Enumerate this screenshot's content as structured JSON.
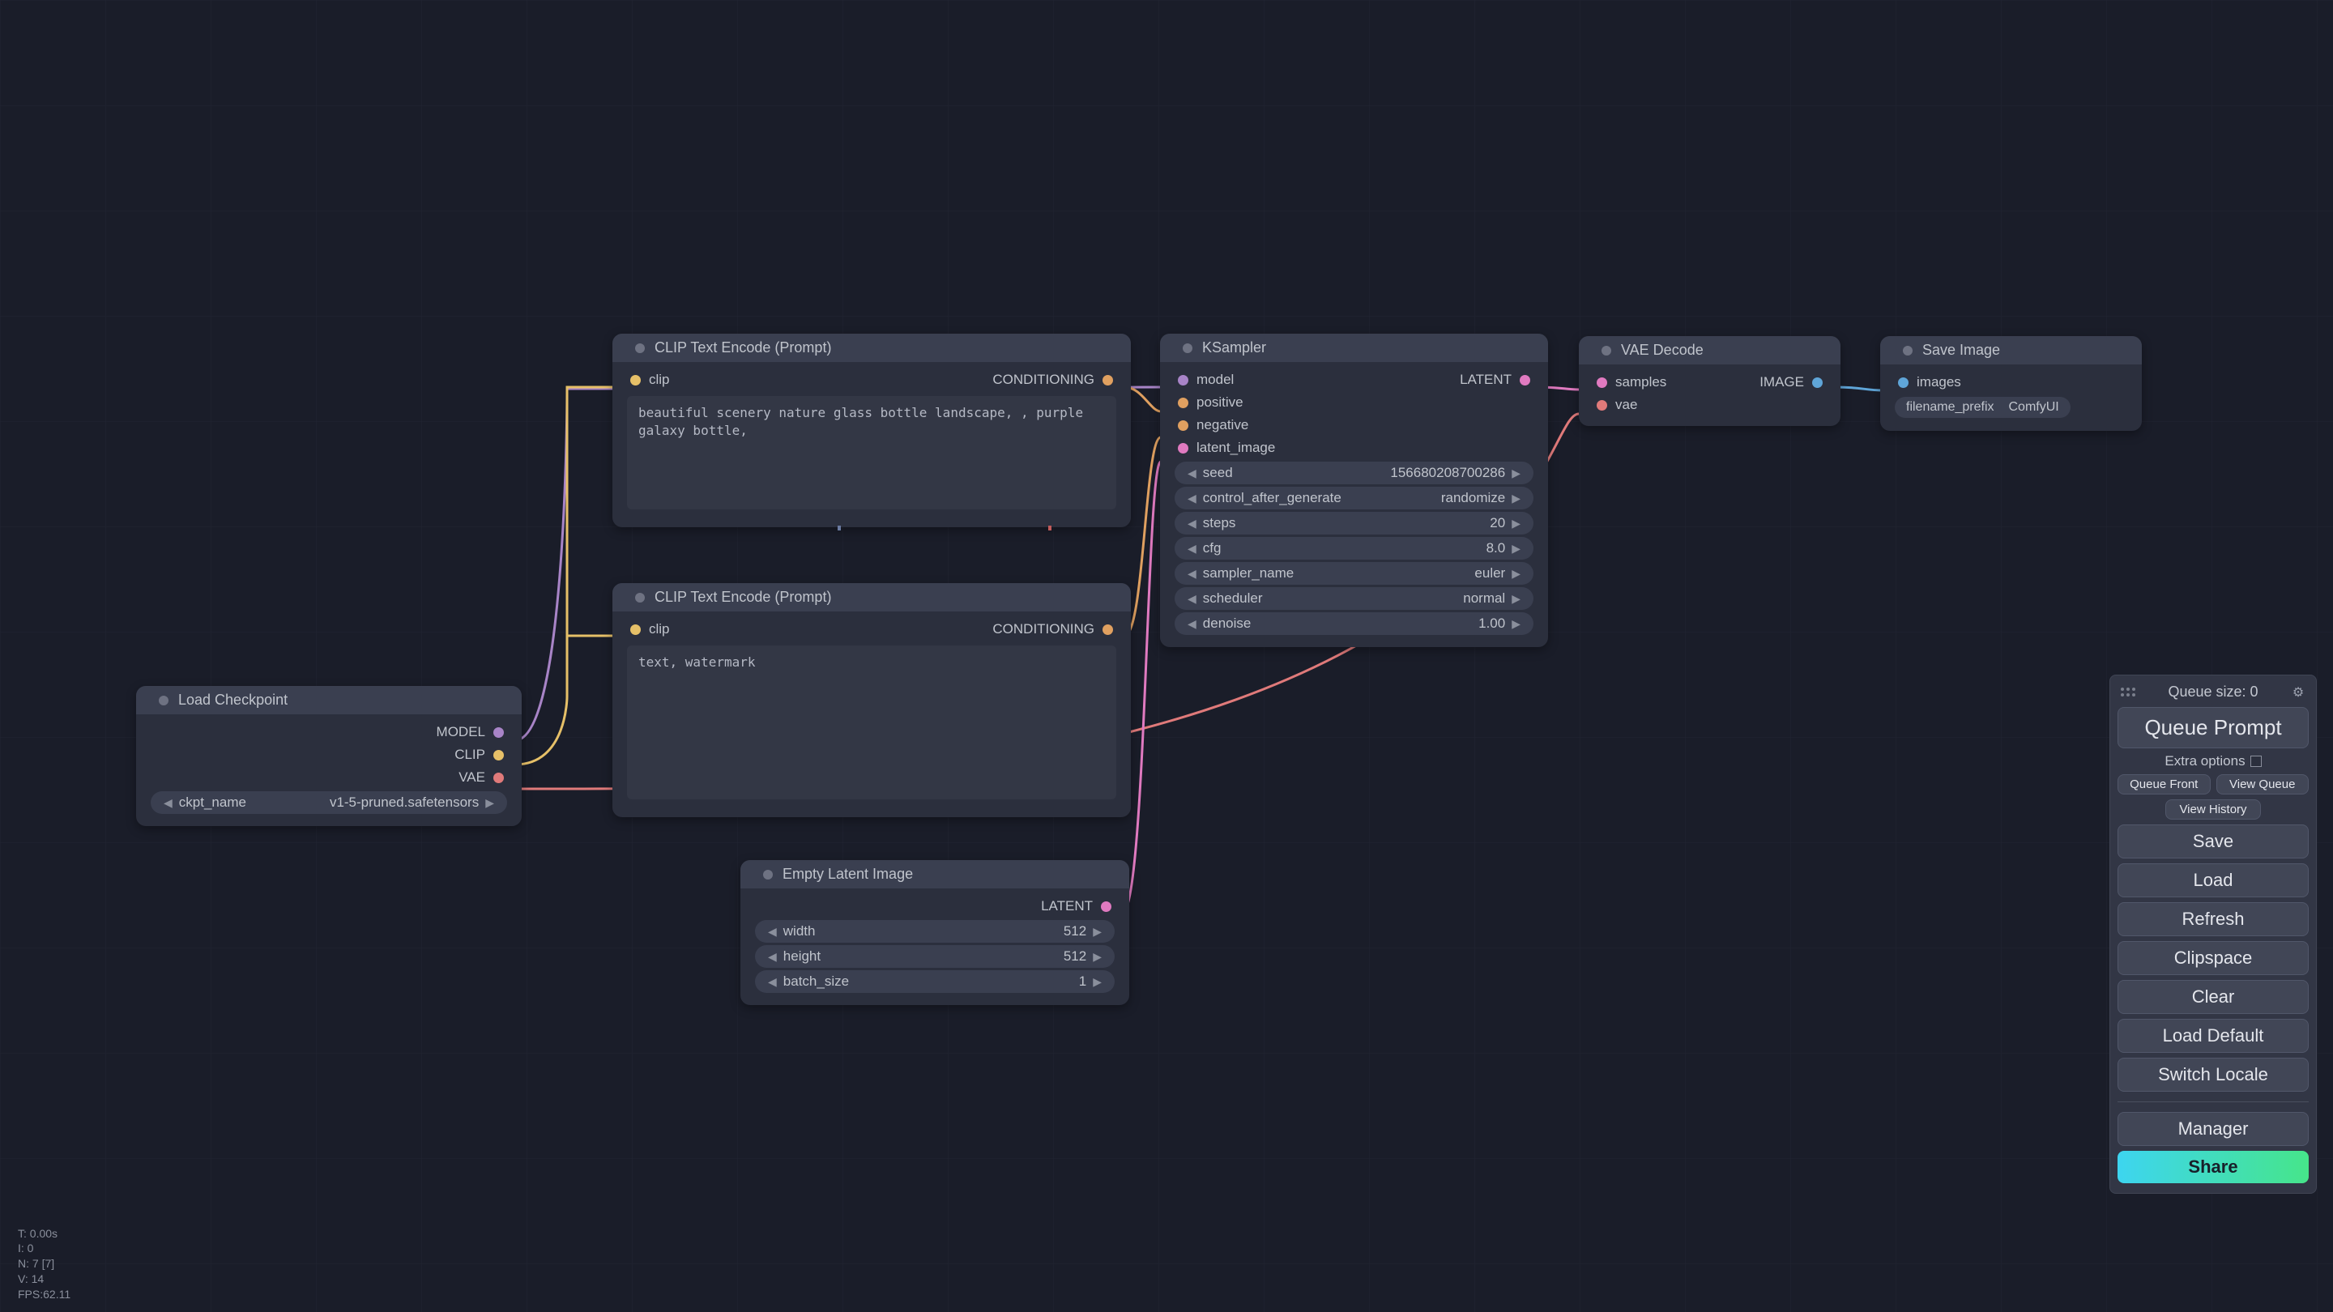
{
  "nodes": {
    "loadckpt": {
      "title": "Load Checkpoint",
      "outputs": [
        "MODEL",
        "CLIP",
        "VAE"
      ],
      "param_name": "ckpt_name",
      "param_value": "v1-5-pruned.safetensors"
    },
    "clip_pos": {
      "title": "CLIP Text Encode (Prompt)",
      "in": "clip",
      "out": "CONDITIONING",
      "text": "beautiful scenery nature glass bottle landscape, , purple galaxy bottle,"
    },
    "clip_neg": {
      "title": "CLIP Text Encode (Prompt)",
      "in": "clip",
      "out": "CONDITIONING",
      "text": "text, watermark"
    },
    "empty_latent": {
      "title": "Empty Latent Image",
      "out": "LATENT",
      "params": [
        {
          "name": "width",
          "value": "512"
        },
        {
          "name": "height",
          "value": "512"
        },
        {
          "name": "batch_size",
          "value": "1"
        }
      ]
    },
    "ksampler": {
      "title": "KSampler",
      "ins": [
        "model",
        "positive",
        "negative",
        "latent_image"
      ],
      "out": "LATENT",
      "params": [
        {
          "name": "seed",
          "value": "156680208700286"
        },
        {
          "name": "control_after_generate",
          "value": "randomize"
        },
        {
          "name": "steps",
          "value": "20"
        },
        {
          "name": "cfg",
          "value": "8.0"
        },
        {
          "name": "sampler_name",
          "value": "euler"
        },
        {
          "name": "scheduler",
          "value": "normal"
        },
        {
          "name": "denoise",
          "value": "1.00"
        }
      ]
    },
    "vae": {
      "title": "VAE Decode",
      "ins": [
        "samples",
        "vae"
      ],
      "out": "IMAGE"
    },
    "save": {
      "title": "Save Image",
      "in": "images",
      "param_name": "filename_prefix",
      "param_value": "ComfyUI"
    }
  },
  "panel": {
    "queue_size": "Queue size: 0",
    "queue_prompt": "Queue Prompt",
    "extra_options": "Extra options",
    "queue_front": "Queue Front",
    "view_queue": "View Queue",
    "view_history": "View History",
    "save": "Save",
    "load": "Load",
    "refresh": "Refresh",
    "clipspace": "Clipspace",
    "clear": "Clear",
    "load_default": "Load Default",
    "switch_locale": "Switch Locale",
    "manager": "Manager",
    "share": "Share"
  },
  "stats": {
    "l1": "T: 0.00s",
    "l2": "I: 0",
    "l3": "N: 7 [7]",
    "l4": "V: 14",
    "l5": "FPS:62.11"
  }
}
